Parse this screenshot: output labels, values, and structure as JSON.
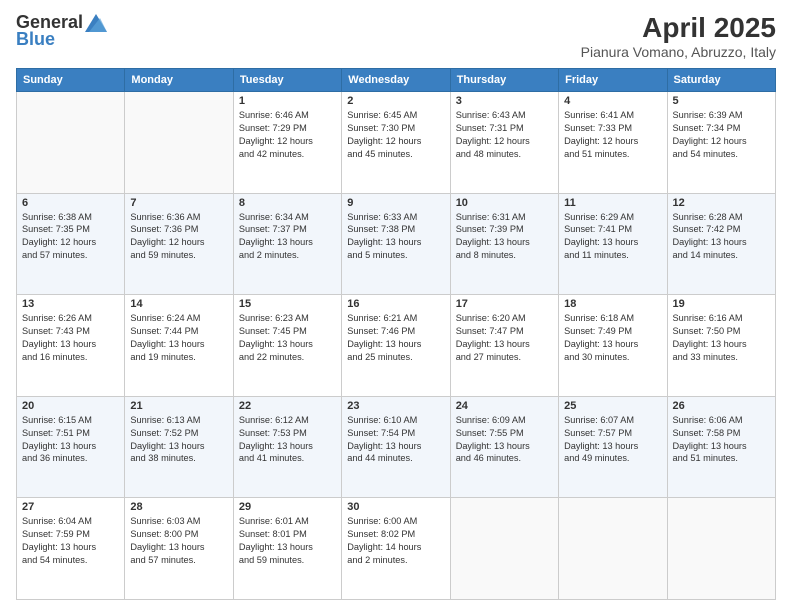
{
  "header": {
    "logo_general": "General",
    "logo_blue": "Blue",
    "title": "April 2025",
    "subtitle": "Pianura Vomano, Abruzzo, Italy"
  },
  "weekdays": [
    "Sunday",
    "Monday",
    "Tuesday",
    "Wednesday",
    "Thursday",
    "Friday",
    "Saturday"
  ],
  "weeks": [
    [
      {
        "day": "",
        "info": ""
      },
      {
        "day": "",
        "info": ""
      },
      {
        "day": "1",
        "info": "Sunrise: 6:46 AM\nSunset: 7:29 PM\nDaylight: 12 hours\nand 42 minutes."
      },
      {
        "day": "2",
        "info": "Sunrise: 6:45 AM\nSunset: 7:30 PM\nDaylight: 12 hours\nand 45 minutes."
      },
      {
        "day": "3",
        "info": "Sunrise: 6:43 AM\nSunset: 7:31 PM\nDaylight: 12 hours\nand 48 minutes."
      },
      {
        "day": "4",
        "info": "Sunrise: 6:41 AM\nSunset: 7:33 PM\nDaylight: 12 hours\nand 51 minutes."
      },
      {
        "day": "5",
        "info": "Sunrise: 6:39 AM\nSunset: 7:34 PM\nDaylight: 12 hours\nand 54 minutes."
      }
    ],
    [
      {
        "day": "6",
        "info": "Sunrise: 6:38 AM\nSunset: 7:35 PM\nDaylight: 12 hours\nand 57 minutes."
      },
      {
        "day": "7",
        "info": "Sunrise: 6:36 AM\nSunset: 7:36 PM\nDaylight: 12 hours\nand 59 minutes."
      },
      {
        "day": "8",
        "info": "Sunrise: 6:34 AM\nSunset: 7:37 PM\nDaylight: 13 hours\nand 2 minutes."
      },
      {
        "day": "9",
        "info": "Sunrise: 6:33 AM\nSunset: 7:38 PM\nDaylight: 13 hours\nand 5 minutes."
      },
      {
        "day": "10",
        "info": "Sunrise: 6:31 AM\nSunset: 7:39 PM\nDaylight: 13 hours\nand 8 minutes."
      },
      {
        "day": "11",
        "info": "Sunrise: 6:29 AM\nSunset: 7:41 PM\nDaylight: 13 hours\nand 11 minutes."
      },
      {
        "day": "12",
        "info": "Sunrise: 6:28 AM\nSunset: 7:42 PM\nDaylight: 13 hours\nand 14 minutes."
      }
    ],
    [
      {
        "day": "13",
        "info": "Sunrise: 6:26 AM\nSunset: 7:43 PM\nDaylight: 13 hours\nand 16 minutes."
      },
      {
        "day": "14",
        "info": "Sunrise: 6:24 AM\nSunset: 7:44 PM\nDaylight: 13 hours\nand 19 minutes."
      },
      {
        "day": "15",
        "info": "Sunrise: 6:23 AM\nSunset: 7:45 PM\nDaylight: 13 hours\nand 22 minutes."
      },
      {
        "day": "16",
        "info": "Sunrise: 6:21 AM\nSunset: 7:46 PM\nDaylight: 13 hours\nand 25 minutes."
      },
      {
        "day": "17",
        "info": "Sunrise: 6:20 AM\nSunset: 7:47 PM\nDaylight: 13 hours\nand 27 minutes."
      },
      {
        "day": "18",
        "info": "Sunrise: 6:18 AM\nSunset: 7:49 PM\nDaylight: 13 hours\nand 30 minutes."
      },
      {
        "day": "19",
        "info": "Sunrise: 6:16 AM\nSunset: 7:50 PM\nDaylight: 13 hours\nand 33 minutes."
      }
    ],
    [
      {
        "day": "20",
        "info": "Sunrise: 6:15 AM\nSunset: 7:51 PM\nDaylight: 13 hours\nand 36 minutes."
      },
      {
        "day": "21",
        "info": "Sunrise: 6:13 AM\nSunset: 7:52 PM\nDaylight: 13 hours\nand 38 minutes."
      },
      {
        "day": "22",
        "info": "Sunrise: 6:12 AM\nSunset: 7:53 PM\nDaylight: 13 hours\nand 41 minutes."
      },
      {
        "day": "23",
        "info": "Sunrise: 6:10 AM\nSunset: 7:54 PM\nDaylight: 13 hours\nand 44 minutes."
      },
      {
        "day": "24",
        "info": "Sunrise: 6:09 AM\nSunset: 7:55 PM\nDaylight: 13 hours\nand 46 minutes."
      },
      {
        "day": "25",
        "info": "Sunrise: 6:07 AM\nSunset: 7:57 PM\nDaylight: 13 hours\nand 49 minutes."
      },
      {
        "day": "26",
        "info": "Sunrise: 6:06 AM\nSunset: 7:58 PM\nDaylight: 13 hours\nand 51 minutes."
      }
    ],
    [
      {
        "day": "27",
        "info": "Sunrise: 6:04 AM\nSunset: 7:59 PM\nDaylight: 13 hours\nand 54 minutes."
      },
      {
        "day": "28",
        "info": "Sunrise: 6:03 AM\nSunset: 8:00 PM\nDaylight: 13 hours\nand 57 minutes."
      },
      {
        "day": "29",
        "info": "Sunrise: 6:01 AM\nSunset: 8:01 PM\nDaylight: 13 hours\nand 59 minutes."
      },
      {
        "day": "30",
        "info": "Sunrise: 6:00 AM\nSunset: 8:02 PM\nDaylight: 14 hours\nand 2 minutes."
      },
      {
        "day": "",
        "info": ""
      },
      {
        "day": "",
        "info": ""
      },
      {
        "day": "",
        "info": ""
      }
    ]
  ]
}
